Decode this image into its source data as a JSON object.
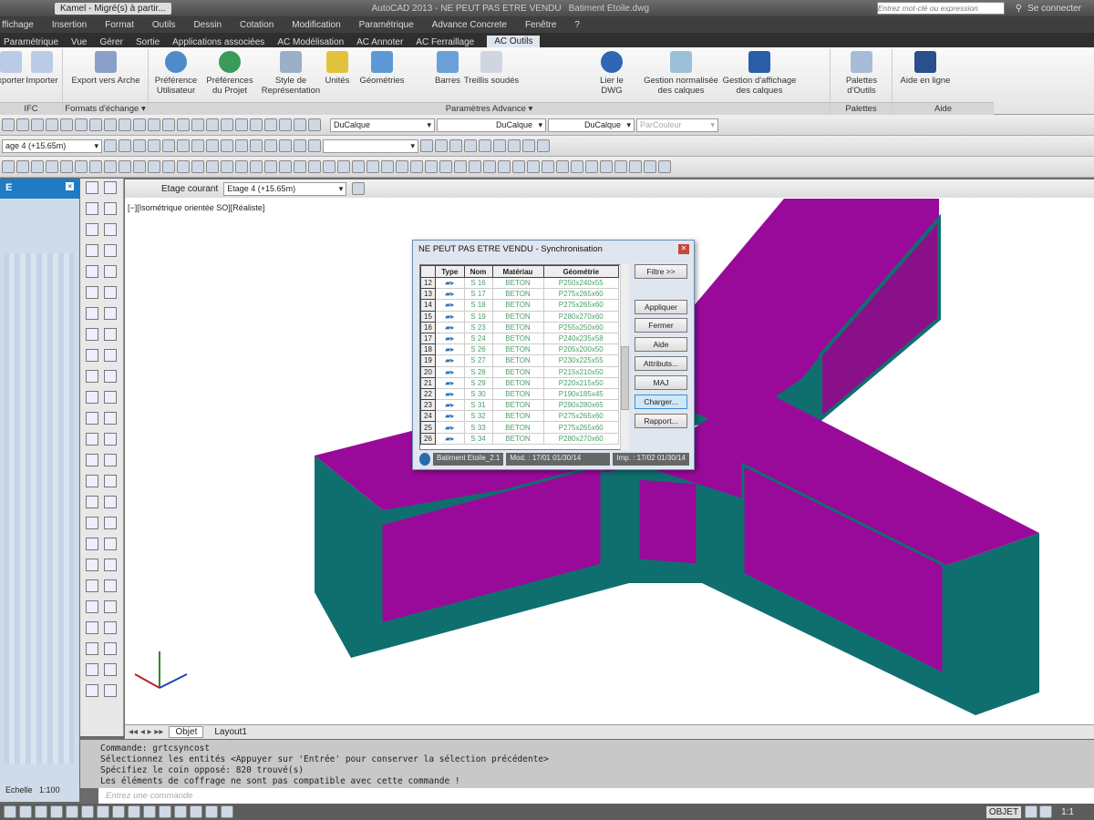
{
  "titlebar": {
    "workspace": "Kamel - Migré(s) à partir...",
    "app_title": "AutoCAD 2013 - NE PEUT PAS ETRE VENDU",
    "filename": "Batiment Etoile.dwg",
    "search_placeholder": "Entrez mot-clé ou expression",
    "signin": "Se connecter"
  },
  "menu": [
    "ffichage",
    "Insertion",
    "Format",
    "Outils",
    "Dessin",
    "Cotation",
    "Modification",
    "Paramétrique",
    "Advance Concrete",
    "Fenêtre",
    "?"
  ],
  "ribbon_tabs": [
    "Paramétrique",
    "Vue",
    "Gérer",
    "Sortie",
    "Applications associées",
    "AC Modélisation",
    "AC Annoter",
    "AC Ferraillage",
    "AC Outils"
  ],
  "ribbon_active_tab": "AC Outils",
  "ribbon": {
    "buttons": [
      "xporter",
      "Importer",
      "Export vers Arche",
      "Préférence Utilisateur",
      "Préférences du Projet",
      "Style de Représentation",
      "Unités",
      "Géométries",
      "Barres",
      "Treillis soudés",
      "Lier le DWG",
      "Gestion normalisée des calques",
      "Gestion d'affichage des calques",
      "Palettes d'Outils",
      "Aide en ligne"
    ],
    "panels": [
      "IFC",
      "Formats d'échange ▾",
      "Paramètres Advance ▾",
      "Palettes d'Outils",
      "Aide"
    ]
  },
  "toolbars": {
    "color": "DuCalque",
    "linetype": "DuCalque",
    "lineweight": "DuCalque",
    "plotstyle": "ParCouleur",
    "layer": "age 4 (+15.65m)"
  },
  "etage": {
    "label": "Etage courant",
    "value": "Etage 4 (+15.65m)"
  },
  "viewport": {
    "label": "[−][Isométrique orientée SO][Réaliste]"
  },
  "palette": {
    "title": "E",
    "scale_label": "Echelle",
    "scale_value": "1:100"
  },
  "layout_tabs": [
    "Objet",
    "Layout1"
  ],
  "dialog": {
    "title": "NE PEUT PAS ETRE VENDU - Synchronisation",
    "columns": [
      "",
      "Type",
      "Nom",
      "Matériau",
      "Géométrie"
    ],
    "rows": [
      {
        "n": "12",
        "nom": "S 16",
        "mat": "BETON",
        "geo": "P250x240x55"
      },
      {
        "n": "13",
        "nom": "S 17",
        "mat": "BETON",
        "geo": "P275x265x60"
      },
      {
        "n": "14",
        "nom": "S 18",
        "mat": "BETON",
        "geo": "P275x265x60"
      },
      {
        "n": "15",
        "nom": "S 19",
        "mat": "BETON",
        "geo": "P280x270x60"
      },
      {
        "n": "16",
        "nom": "S 23",
        "mat": "BETON",
        "geo": "P255x250x60"
      },
      {
        "n": "17",
        "nom": "S 24",
        "mat": "BETON",
        "geo": "P240x235x58"
      },
      {
        "n": "18",
        "nom": "S 26",
        "mat": "BETON",
        "geo": "P205x200x50"
      },
      {
        "n": "19",
        "nom": "S 27",
        "mat": "BETON",
        "geo": "P230x225x55"
      },
      {
        "n": "20",
        "nom": "S 28",
        "mat": "BETON",
        "geo": "P215x210x50"
      },
      {
        "n": "21",
        "nom": "S 29",
        "mat": "BETON",
        "geo": "P220x215x50"
      },
      {
        "n": "22",
        "nom": "S 30",
        "mat": "BETON",
        "geo": "P190x185x45"
      },
      {
        "n": "23",
        "nom": "S 31",
        "mat": "BETON",
        "geo": "P290x280x65"
      },
      {
        "n": "24",
        "nom": "S 32",
        "mat": "BETON",
        "geo": "P275x265x60"
      },
      {
        "n": "25",
        "nom": "S 33",
        "mat": "BETON",
        "geo": "P275x265x60"
      },
      {
        "n": "26",
        "nom": "S 34",
        "mat": "BETON",
        "geo": "P280x270x60"
      }
    ],
    "buttons": [
      "Filtre >>",
      "Appliquer",
      "Fermer",
      "Aide",
      "Attributs...",
      "MAJ",
      "Charger...",
      "Rapport..."
    ],
    "status": [
      "Batiment Etoile_2.1",
      "Mod. : 17/01 01/30/14",
      "Imp. : 17/02 01/30/14"
    ]
  },
  "command": {
    "lines": [
      "Commande: grtcsyncost",
      "Sélectionnez les entités  <Appuyer sur 'Entrée' pour conserver la sélection précédente>",
      "Spécifiez le coin opposé: 820 trouvé(s)",
      "Les éléments de coffrage ne sont pas compatible avec cette commande !"
    ],
    "placeholder": "Entrez une commande"
  },
  "status": {
    "mode": "OBJET",
    "annoscale": "1:1"
  },
  "colors": {
    "roof": "#9a0a9a",
    "wall": "#0f6f6f",
    "accent": "#1e7bc4"
  }
}
